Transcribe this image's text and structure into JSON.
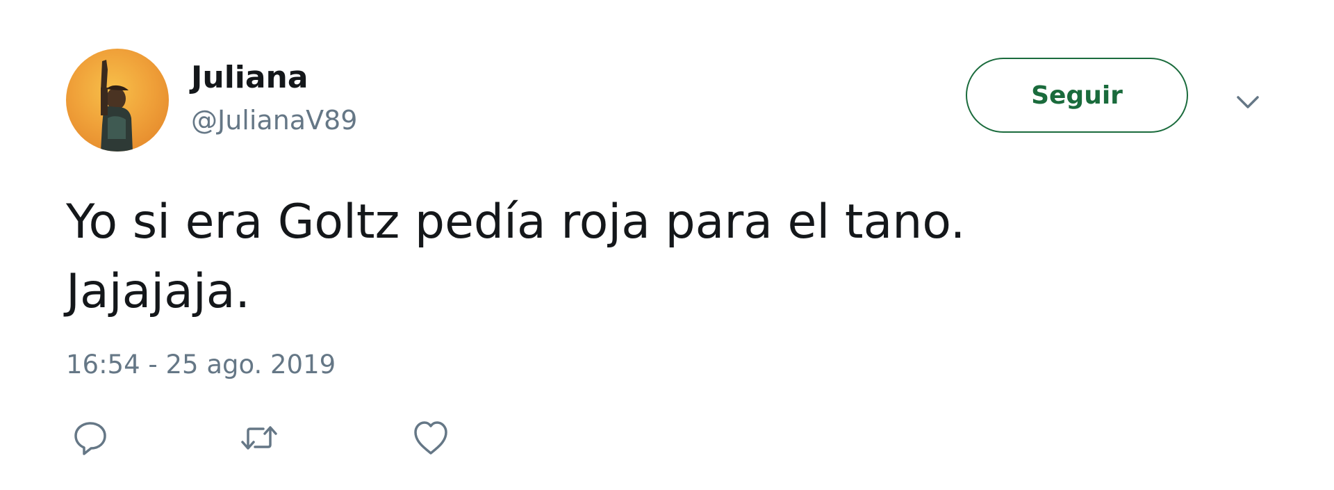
{
  "user": {
    "name": "Juliana",
    "handle": "@JulianaV89"
  },
  "follow_button": {
    "label": "Seguir"
  },
  "tweet": {
    "text_lines": [
      "Yo si era Goltz pedía roja para el tano.",
      "Jajajaja."
    ],
    "timestamp": "16:54 - 25 ago. 2019"
  },
  "actions": {
    "reply_icon": "reply-icon",
    "retweet_icon": "retweet-icon",
    "like_icon": "heart-icon",
    "more_icon": "chevron-down-icon"
  },
  "colors": {
    "accent": "#1a6b3c",
    "secondary_text": "#657786",
    "primary_text": "#14171a",
    "icon": "#657786"
  }
}
